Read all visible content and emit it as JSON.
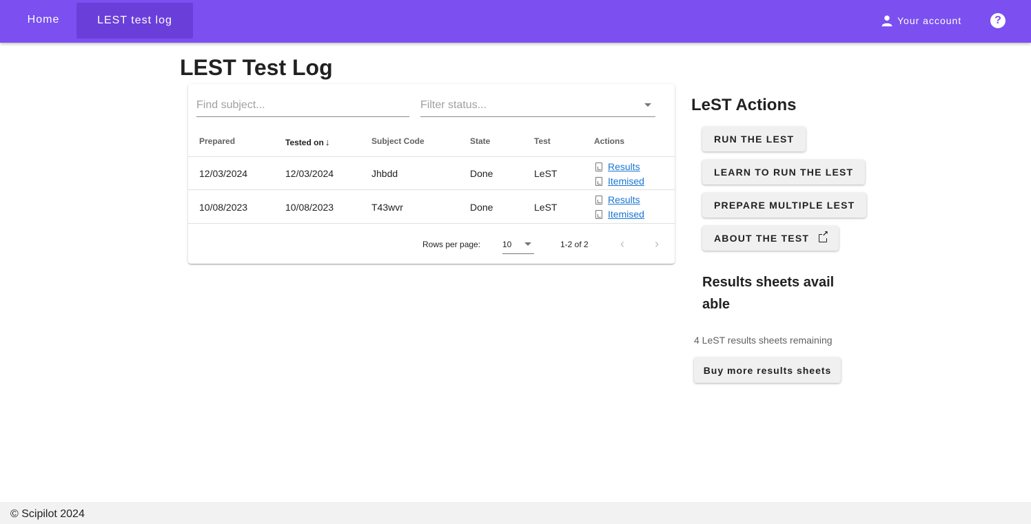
{
  "nav": {
    "home": "Home",
    "log": "LEST test log",
    "account": "Your account",
    "help_icon": "help-icon",
    "account_icon": "person-icon",
    "color": "#7b4ff0"
  },
  "page_title": "LEST Test Log",
  "filters": {
    "subject_placeholder": "Find subject...",
    "status_placeholder": "Filter status..."
  },
  "table": {
    "headers": [
      "Prepared",
      "Tested on",
      "Subject Code",
      "State",
      "Test",
      "Actions"
    ],
    "sorted_column": "Tested on",
    "sort_direction": "descending",
    "rows": [
      {
        "prepared": "12/03/2024",
        "tested_on": "12/03/2024",
        "subject": "Jhbdd",
        "state": "Done",
        "test": "LeST",
        "action1": " Results",
        "action2": " Itemised"
      },
      {
        "prepared": "10/08/2023",
        "tested_on": "10/08/2023",
        "subject": "T43wvr",
        "state": "Done",
        "test": "LeST",
        "action1": " Results",
        "action2": " Itemised"
      }
    ],
    "pagination": {
      "rows_label": "Rows per page:",
      "rows_value": "10",
      "range": "1-2 of 2"
    }
  },
  "side": {
    "title": "LeST Actions",
    "buttons": [
      "RUN THE LEST",
      "LEARN TO RUN THE LEST",
      "PREPARE MULTIPLE LEST",
      "ABOUT THE TEST"
    ],
    "sheets_title": "Results sheets available",
    "sheets_remaining": "4 LeST results sheets remaining",
    "buy_button": "Buy more results sheets"
  },
  "footer": "© Scipilot 2024"
}
